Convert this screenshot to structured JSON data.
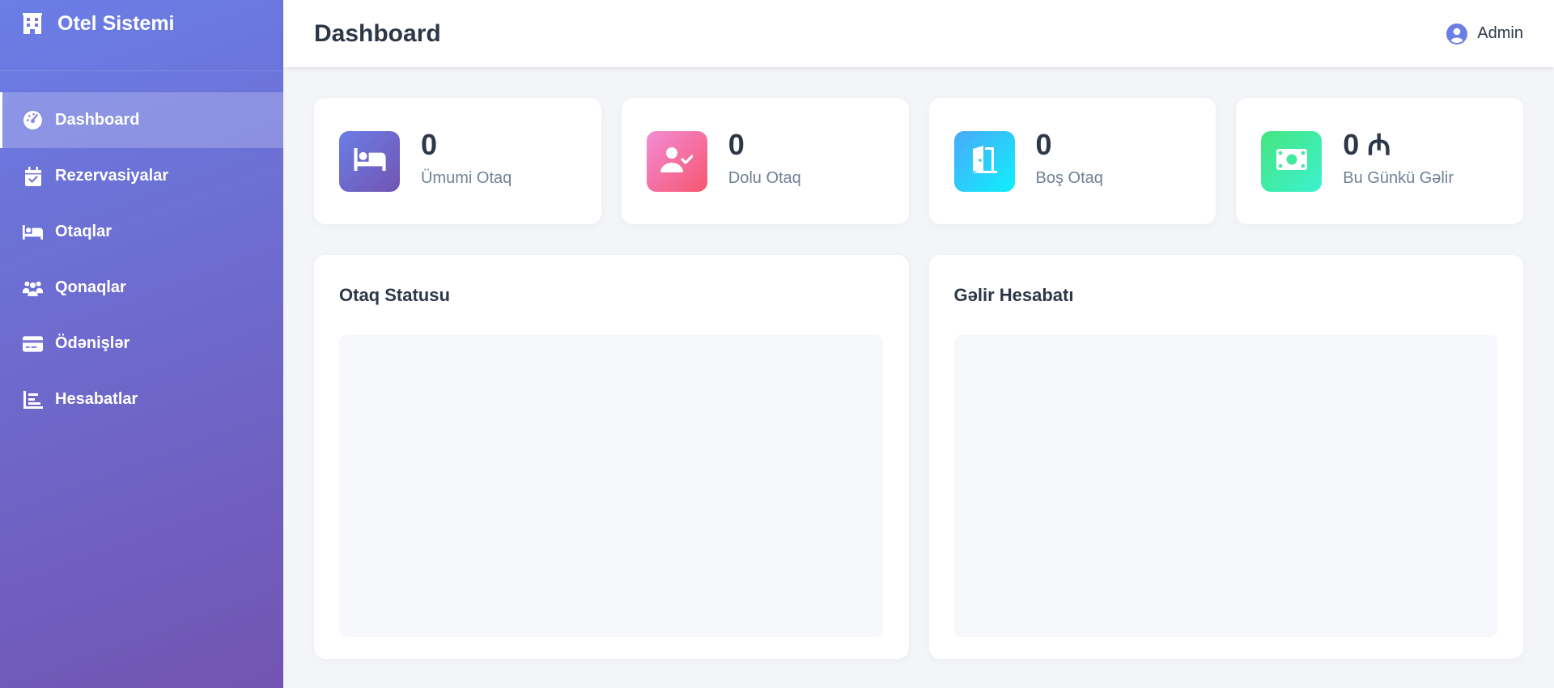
{
  "brand": {
    "title": "Otel Sistemi",
    "icon": "hotel-icon"
  },
  "sidebar": {
    "items": [
      {
        "label": "Dashboard",
        "icon": "gauge-icon",
        "active": true
      },
      {
        "label": "Rezervasiyalar",
        "icon": "calendar-check-icon",
        "active": false
      },
      {
        "label": "Otaqlar",
        "icon": "bed-icon",
        "active": false
      },
      {
        "label": "Qonaqlar",
        "icon": "users-icon",
        "active": false
      },
      {
        "label": "Ödənişlər",
        "icon": "credit-card-icon",
        "active": false
      },
      {
        "label": "Hesabatlar",
        "icon": "chart-bar-icon",
        "active": false
      }
    ]
  },
  "header": {
    "title": "Dashboard",
    "user": "Admin"
  },
  "stats": [
    {
      "value": "0",
      "label": "Ümumi Otaq",
      "icon": "bed-icon",
      "gradient": [
        "#6a7ee6",
        "#7254b2"
      ]
    },
    {
      "value": "0",
      "label": "Dolu Otaq",
      "icon": "user-check-icon",
      "gradient": [
        "#f48cd6",
        "#f5566f"
      ]
    },
    {
      "value": "0",
      "label": "Boş Otaq",
      "icon": "door-open-icon",
      "gradient": [
        "#4aa9f8",
        "#0ef0fd"
      ]
    },
    {
      "value": "0 ₼",
      "label": "Bu Günkü Gəlir",
      "icon": "money-bill-icon",
      "gradient": [
        "#45e57f",
        "#3cf2cf"
      ]
    }
  ],
  "panels": [
    {
      "title": "Otaq Statusu"
    },
    {
      "title": "Gəlir Hesabatı"
    }
  ]
}
